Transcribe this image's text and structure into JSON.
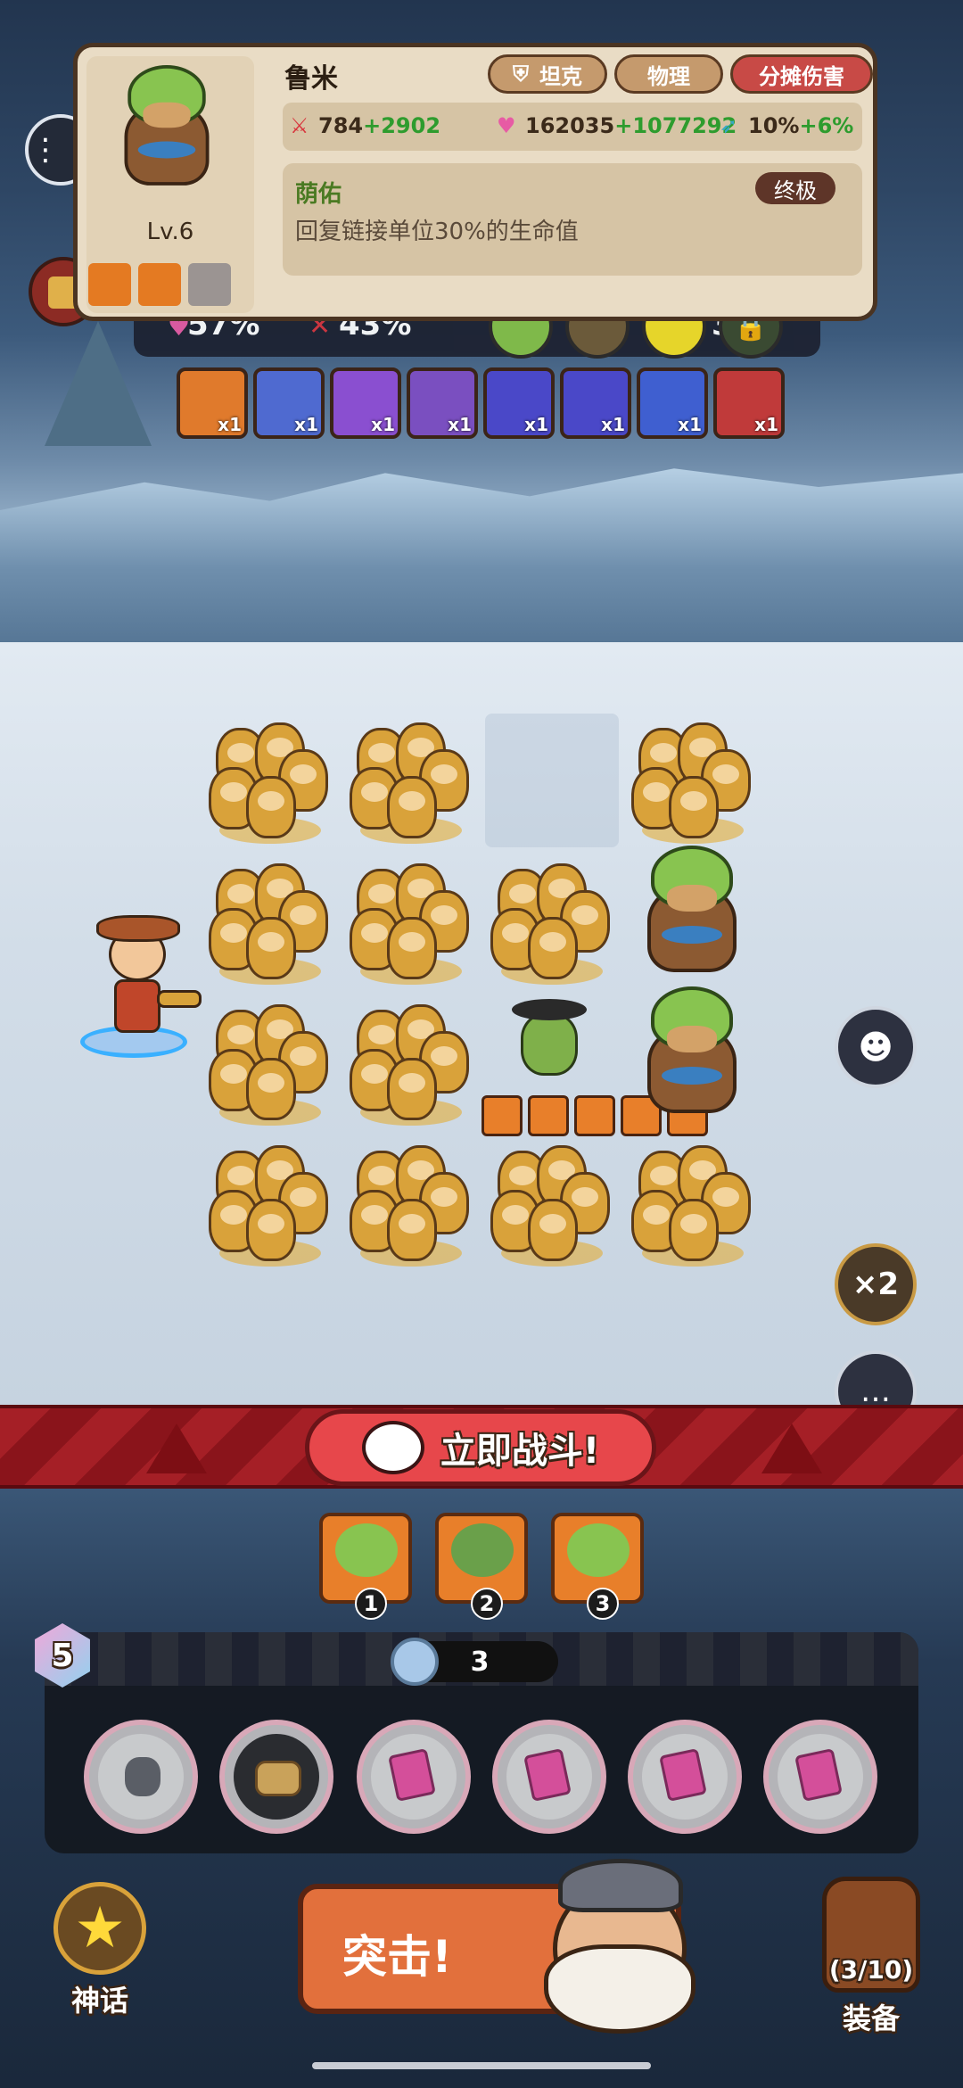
{
  "unit_card": {
    "name": "鲁米",
    "level": "Lv.6",
    "tags": [
      "坦克",
      "物理",
      "分摊伤害"
    ],
    "stats": {
      "attack": "784",
      "attack_bonus": "+2902",
      "hp": "162035",
      "hp_bonus": "+1077292",
      "crit": "10%",
      "crit_bonus": "+6%"
    },
    "skill": {
      "name": "荫佑",
      "rank": "终极",
      "description": "回复链接单位30%的生命值"
    }
  },
  "top_bar": {
    "left_value": "57%",
    "right_value": "43%",
    "extra_value": "3"
  },
  "items": [
    {
      "icon": "item-icon",
      "count": "x1"
    },
    {
      "icon": "item-icon",
      "count": "x1"
    },
    {
      "icon": "item-icon",
      "count": "x1"
    },
    {
      "icon": "item-icon",
      "count": "x1"
    },
    {
      "icon": "item-icon",
      "count": "x1"
    },
    {
      "icon": "item-icon",
      "count": "x1"
    },
    {
      "icon": "item-icon",
      "count": "x1"
    },
    {
      "icon": "item-icon",
      "count": "x1"
    }
  ],
  "speed_button": "×2",
  "fight_button": "立即战斗!",
  "queue": [
    "1",
    "2",
    "3"
  ],
  "shop": {
    "level": "5",
    "currency": "3"
  },
  "attack_button": "突击!",
  "myth_label": "神话",
  "equip": {
    "count": "(3/10)",
    "label": "装备"
  },
  "colors": {
    "accent_red": "#a51f26",
    "card_bg": "#e9dcc5",
    "bonus_green": "#2e9c2e",
    "fight_btn": "#e7474b"
  }
}
